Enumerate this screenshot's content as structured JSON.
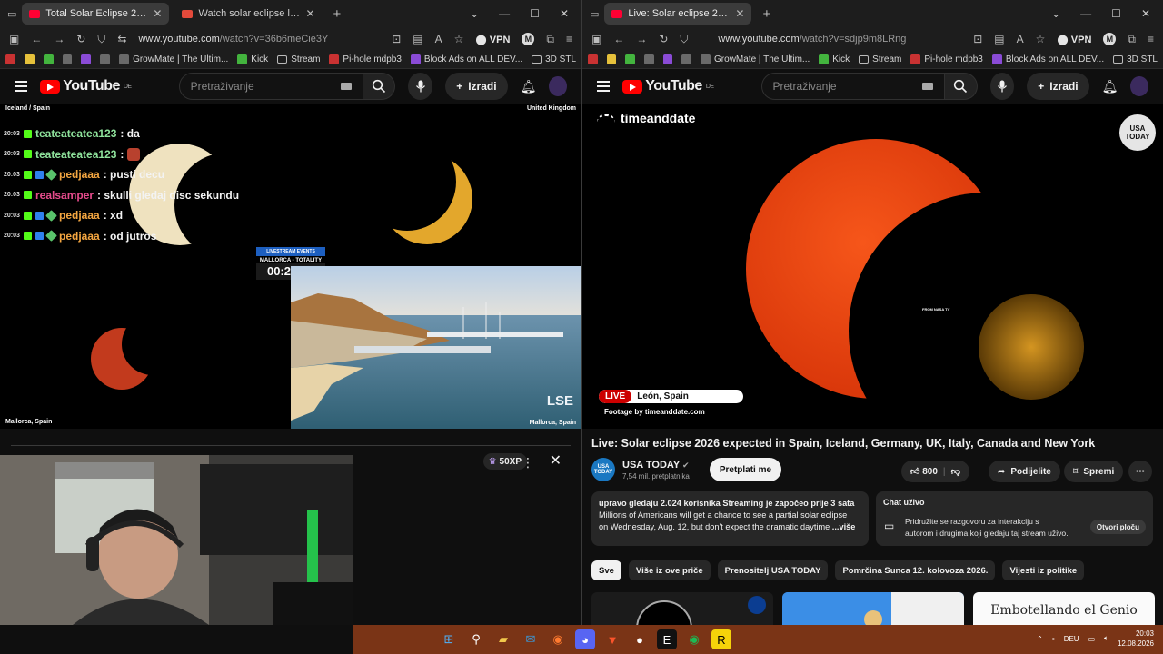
{
  "left": {
    "tabs": [
      {
        "title": "Total Solar Eclipse 2026 Live from",
        "active": true
      },
      {
        "title": "Watch solar eclipse live from",
        "active": false
      }
    ],
    "url_prefix": "www.youtube.com",
    "url_rest": "/watch?v=36b6meCie3Y",
    "vpn": "VPN",
    "profile": "M",
    "bookmarks": [
      "GrowMate | The Ultim...",
      "Kick",
      "Stream",
      "Pi-hole mdpb3",
      "Block Ads on ALL DEV...",
      "3D STL"
    ],
    "search_placeholder": "Pretraživanje",
    "create_label": "Izradi",
    "logo_text": "YouTube",
    "logo_region": "DE",
    "stream": {
      "label_tl": "Iceland / Spain",
      "label_tr": "United Kingdom",
      "label_bl": "Mallorca, Spain",
      "label_br": "Mallorca, Spain",
      "overlay_top": "LIVESTREAM EVENTS",
      "overlay_place": "MALLORCA - TOTALITY",
      "countdown": "00:28:05",
      "watermark": "LSE",
      "chat": [
        {
          "time": "20:03",
          "user": "teateateatea123",
          "text": ": da",
          "color": "u1",
          "badges": [
            "k"
          ]
        },
        {
          "time": "20:03",
          "user": "teateateatea123",
          "text": ":",
          "color": "u1",
          "badges": [
            "k"
          ],
          "emote": true
        },
        {
          "time": "20:03",
          "user": "pedjaaa",
          "text": ": pusti decu",
          "color": "u2",
          "badges": [
            "k",
            "s",
            "d"
          ]
        },
        {
          "time": "20:03",
          "user": "realsamper",
          "text": ": skulli gledaj disc sekundu",
          "color": "u3",
          "badges": [
            "k"
          ]
        },
        {
          "time": "20:03",
          "user": "pedjaaa",
          "text": ": xd",
          "color": "u2",
          "badges": [
            "k",
            "s",
            "d"
          ]
        },
        {
          "time": "20:03",
          "user": "pedjaaa",
          "text": ": od jutros",
          "color": "u2",
          "badges": [
            "k",
            "s",
            "d"
          ]
        }
      ]
    },
    "panel_xp": "50XP"
  },
  "right": {
    "tabs": [
      {
        "title": "Live: Solar eclipse 2026 expecte",
        "active": true
      }
    ],
    "url_prefix": "www.youtube.com",
    "url_rest": "/watch?v=sdjp9m8LRng",
    "vpn": "VPN",
    "profile": "M",
    "bookmarks": [
      "GrowMate | The Ultim...",
      "Kick",
      "Stream",
      "Pi-hole mdpb3",
      "Block Ads on ALL DEV...",
      "3D STL"
    ],
    "search_placeholder": "Pretraživanje",
    "create_label": "Izradi",
    "logo_text": "YouTube",
    "logo_region": "DE",
    "player": {
      "brand": "timeanddate",
      "corner_logo_l1": "USA",
      "corner_logo_l2": "TODAY",
      "live_tag": "LIVE",
      "live_location": "León, Spain",
      "footage": "Footage by timeanddate.com",
      "nasa_tv": "FROM NASA TV"
    },
    "video_title": "Live: Solar eclipse 2026 expected in Spain, Iceland, Germany, UK, Italy, Canada and New York",
    "channel_name": "USA TODAY",
    "channel_subs": "7,54 mil. pretplatnika",
    "subscribe_label": "Pretplati me",
    "likes": "800",
    "share_label": "Podijelite",
    "save_label": "Spremi",
    "desc_line1": "upravo gledaju 2.024 korisnika  Streaming je započeo prije 3 sata",
    "desc_line2": "Millions of Americans will get a chance to see a partial solar eclipse",
    "desc_line3": "on Wednesday, Aug. 12, but don't expect the dramatic daytime",
    "desc_more": "...više",
    "livechat_title": "Chat uživo",
    "livechat_text": "Pridružite se razgovoru za interakciju s autorom i drugima koji gledaju taj stream uživo.",
    "livechat_open": "Otvori ploču",
    "chips": [
      "Sve",
      "Više iz ove priče",
      "Prenositelj USA TODAY",
      "Pomrčina Sunca 12. kolovoza 2026.",
      "Vijesti iz politike"
    ],
    "thumb3_text": "Embotellando el Genio"
  },
  "taskbar": {
    "lang": "DEU",
    "time": "20:03",
    "date": "12.08.2026"
  }
}
